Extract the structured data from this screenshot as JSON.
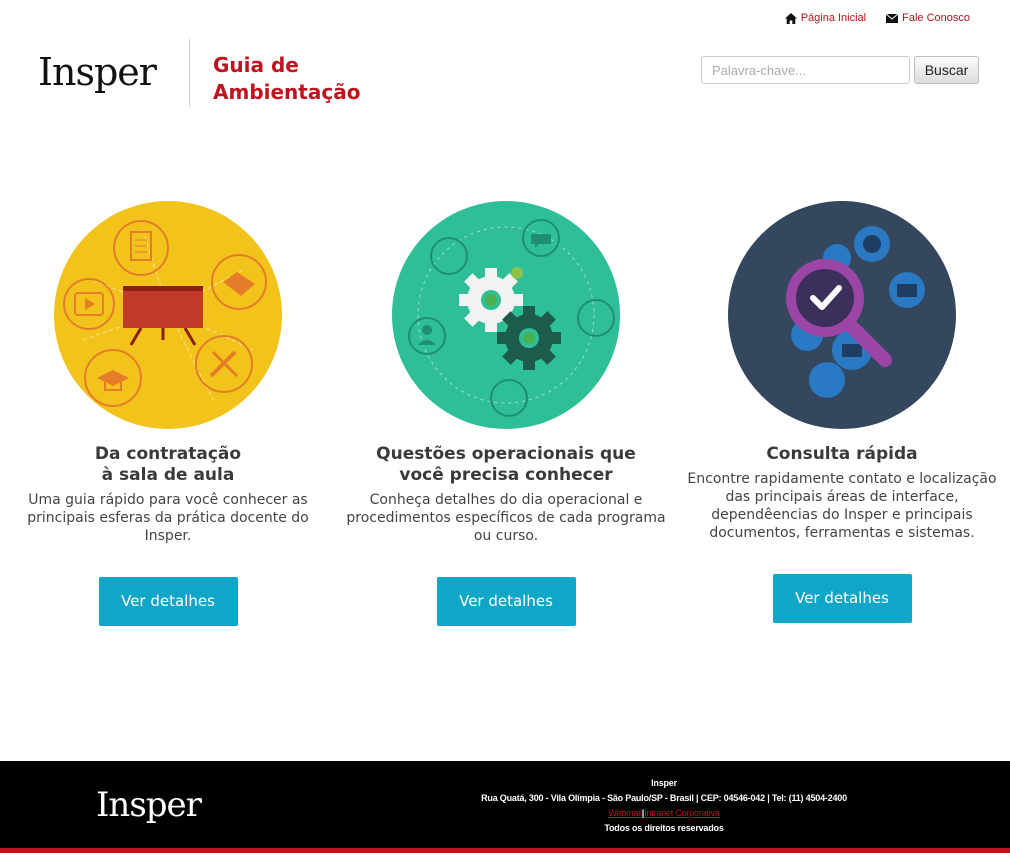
{
  "header": {
    "links": [
      {
        "label": "Página Inicial",
        "icon": "home-icon"
      },
      {
        "label": "Fale Conosco",
        "icon": "mail-icon"
      }
    ],
    "logo": "Insper",
    "title": "Guia de Ambientação",
    "search": {
      "placeholder": "Palavra-chave...",
      "button": "Buscar"
    }
  },
  "cards": [
    {
      "title": "Da contratação\nà sala de aula",
      "text": "Uma guia rápido para você conhecer as principais esferas da prática docente do Insper.",
      "button": "Ver detalhes",
      "color": "#f2c31b",
      "icon": "classroom-illustration-icon"
    },
    {
      "title": "Questões operacionais que\nvocê precisa conhecer",
      "text": "Conheça detalhes do dia operacional e procedimentos específicos de cada programa ou curso.",
      "button": "Ver detalhes",
      "color": "#2fbf98",
      "icon": "gears-illustration-icon"
    },
    {
      "title": "Consulta rápida",
      "text": "Encontre rapidamente contato e localização das principais áreas de interface, dependêencias do Insper e principais documentos, ferramentas e sistemas.",
      "button": "Ver detalhes",
      "color": "#34475e",
      "icon": "magnifier-illustration-icon"
    }
  ],
  "footer": {
    "logo": "Insper",
    "name": "Insper",
    "address": "Rua Quatá, 300 - Vila Olímpia - São Paulo/SP - Brasil | CEP: 04546-042 | Tel: (11) 4504-2400",
    "link1": "Webmail",
    "separator": "|",
    "link2": "Intranet Corporativa",
    "rights": "Todos os direitos reservados"
  },
  "colors": {
    "accent": "#c1121f",
    "button": "#0fa6c8"
  }
}
